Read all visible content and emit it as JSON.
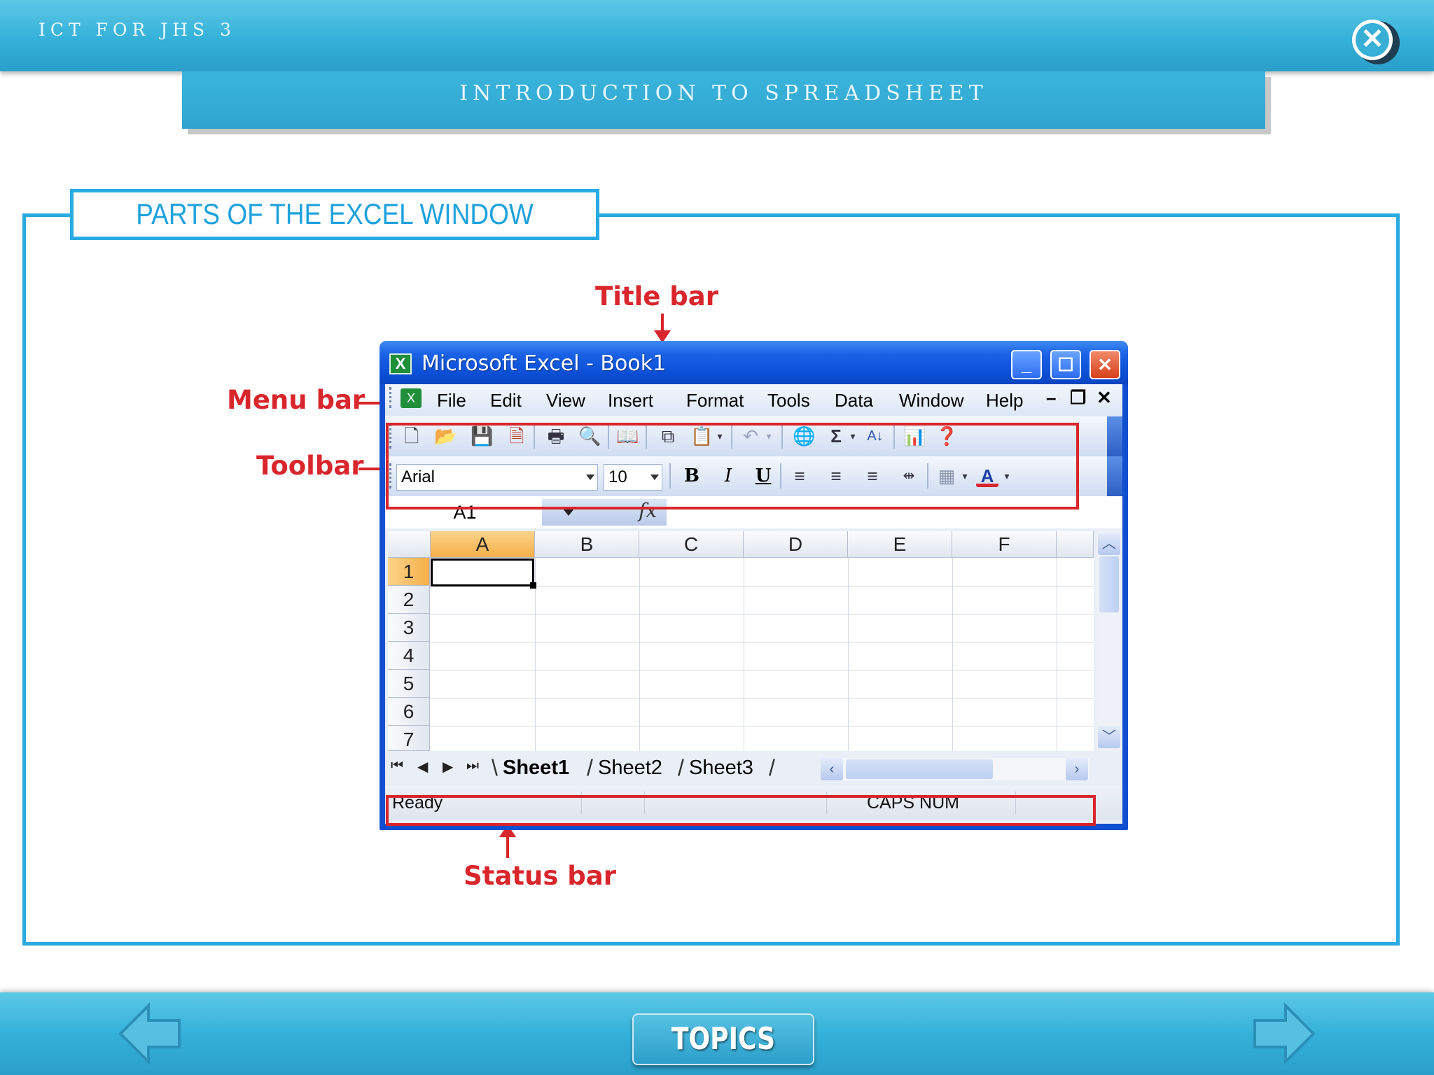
{
  "header": {
    "course": "ICT FOR JHS 3",
    "section": "INTRODUCTION TO SPREADSHEET"
  },
  "content": {
    "heading": "PARTS OF THE EXCEL WINDOW",
    "callouts": {
      "title_bar": "Title bar",
      "menu_bar": "Menu bar",
      "toolbar": "Toolbar",
      "status_bar": "Status bar"
    }
  },
  "excel": {
    "window_title": "Microsoft Excel - Book1",
    "menu": [
      "File",
      "Edit",
      "View",
      "Insert",
      "Format",
      "Tools",
      "Data",
      "Window",
      "Help"
    ],
    "font_name": "Arial",
    "font_size": "10",
    "name_box": "A1",
    "fx": "fx",
    "columns": [
      "A",
      "B",
      "C",
      "D",
      "E",
      "F"
    ],
    "rows": [
      "1",
      "2",
      "3",
      "4",
      "5",
      "6",
      "7"
    ],
    "sheets": [
      "Sheet1",
      "Sheet2",
      "Sheet3"
    ],
    "status": "Ready",
    "indicators": "CAPS NUM"
  },
  "footer": {
    "topics": "TOPICS"
  },
  "colors": {
    "accent": "#29abe2",
    "callout": "#d8262c",
    "xp_blue": "#0b4fd6"
  }
}
